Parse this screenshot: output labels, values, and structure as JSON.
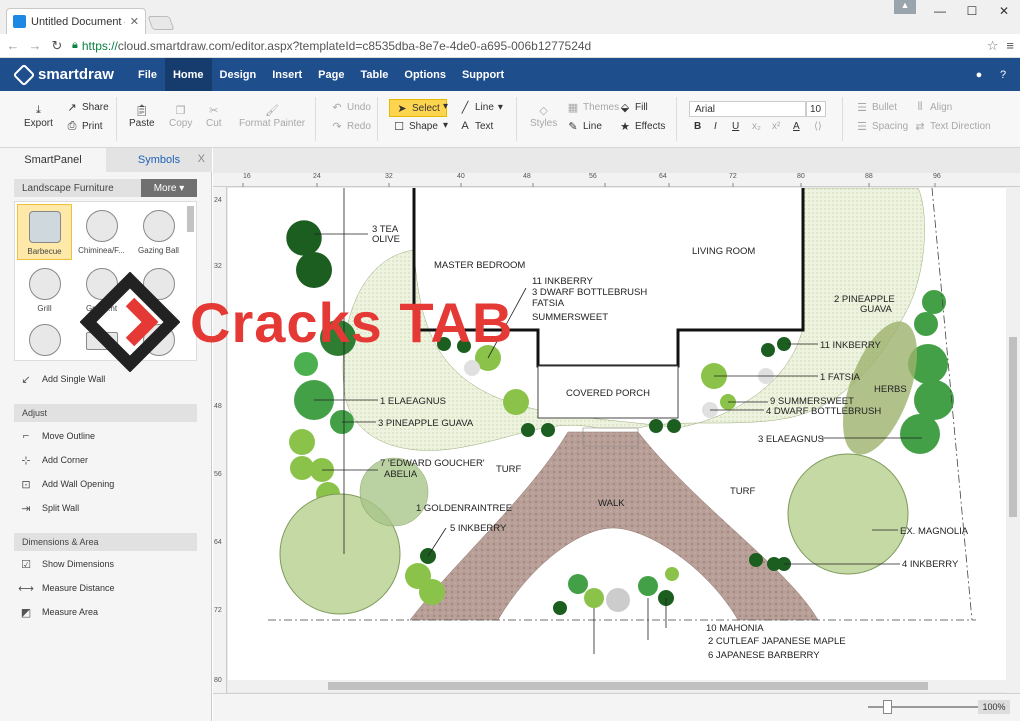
{
  "browser": {
    "tab_title": "Untitled Document — Sm",
    "url_https": "https://",
    "url_rest": "cloud.smartdraw.com/editor.aspx?templateId=c8535dba-8e7e-4de0-a695-006b1277524d"
  },
  "app": {
    "logo_text": "smartdraw",
    "menu": [
      "File",
      "Home",
      "Design",
      "Insert",
      "Page",
      "Table",
      "Options",
      "Support"
    ],
    "active_menu": "Home"
  },
  "ribbon": {
    "export": "Export",
    "share": "Share",
    "print": "Print",
    "paste": "Paste",
    "copy": "Copy",
    "cut": "Cut",
    "format_painter": "Format Painter",
    "undo": "Undo",
    "redo": "Redo",
    "select": "Select",
    "shape": "Shape",
    "line": "Line",
    "text": "Text",
    "styles": "Styles",
    "themes": "Themes",
    "line2": "Line",
    "fill": "Fill",
    "effects": "Effects",
    "font": "Arial",
    "font_size": "10",
    "bullet": "Bullet",
    "align": "Align",
    "spacing": "Spacing",
    "text_direction": "Text Direction"
  },
  "panel": {
    "tab_smartpanel": "SmartPanel",
    "tab_symbols": "Symbols",
    "close": "X",
    "library_name": "Landscape Furniture",
    "more": "More",
    "items": [
      "Barbecue",
      "Chiminea/F...",
      "Gazing Ball",
      "Grill",
      "Grou...nt",
      ""
    ],
    "add_single_wall": "Add Single Wall",
    "adjust_header": "Adjust",
    "move_outline": "Move Outline",
    "add_corner": "Add Corner",
    "add_wall_opening": "Add Wall Opening",
    "split_wall": "Split Wall",
    "dimensions_header": "Dimensions & Area",
    "show_dimensions": "Show Dimensions",
    "measure_distance": "Measure Distance",
    "measure_area": "Measure Area"
  },
  "rulers": {
    "h": [
      "16",
      "24",
      "32",
      "40",
      "48",
      "56",
      "64",
      "72",
      "80",
      "88",
      "96"
    ],
    "v": [
      "24",
      "32",
      "40",
      "48",
      "56",
      "64",
      "72",
      "80"
    ]
  },
  "plan": {
    "rooms": [
      "MASTER BEDROOM",
      "LIVING ROOM",
      "COVERED PORCH",
      "WALK",
      "TURF",
      "TURF",
      "HERBS"
    ],
    "labels": {
      "tea_olive_1": "3 TEA",
      "tea_olive_2": "OLIVE",
      "inkberry_11a": "11 INKBERRY",
      "dwarf_bottlebrush_3": "3 DWARF BOTTLEBRUSH",
      "fatsia_top": "FATSIA",
      "summersweet_top": "SUMMERSWEET",
      "pineapple_guava_2a": "2 PINEAPPLE",
      "pineapple_guava_2b": "GUAVA",
      "inkberry_11b": "11 INKBERRY",
      "fatsia_1": "1 FATSIA",
      "summersweet_9": "9 SUMMERSWEET",
      "dwarf_bottlebrush_4": "4 DWARF BOTTLEBRUSH",
      "elaeagnus_1": "1 ELAEAGNUS",
      "pineapple_guava_3": "3 PINEAPPLE GUAVA",
      "elaeagnus_3": "3 ELAEAGNUS",
      "abelia_1": "7 'EDWARD GOUCHER'",
      "abelia_2": "ABELIA",
      "goldenraintree": "1 GOLDENRAINTREE",
      "inkberry_5": "5 INKBERRY",
      "magnolia": "EX. MAGNOLIA",
      "inkberry_4": "4 INKBERRY",
      "mahonia": "10 MAHONIA",
      "maple": "2 CUTLEAF JAPANESE MAPLE",
      "barberry": "6 JAPANESE BARBERRY"
    }
  },
  "zoom": "100%",
  "watermark": "Cracks TAB"
}
